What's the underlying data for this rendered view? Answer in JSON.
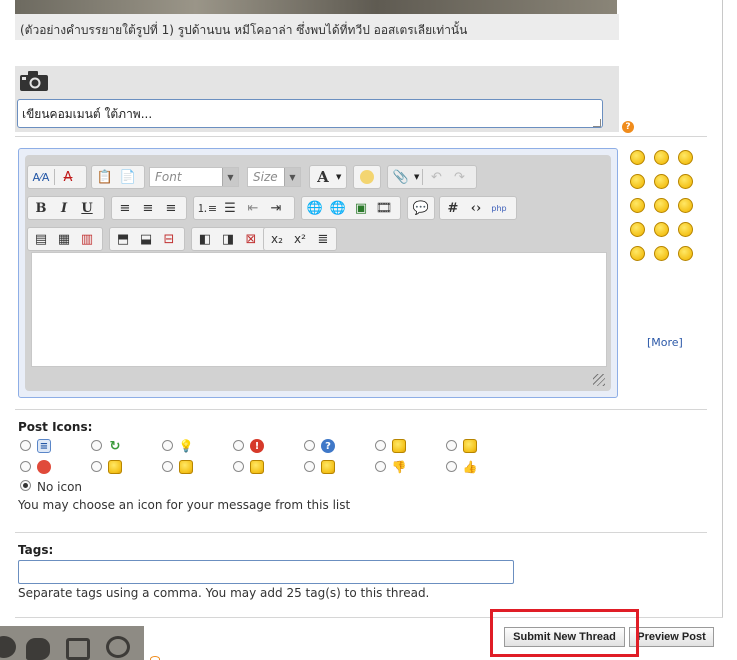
{
  "caption": "(ตัวอย่างคำบรรยายใต้รูปที่ 1) รูปด้านบน หมีโคอาล่า ซึ่งพบได้ที่ทวีป ออสเตรเลียเท่านั้น",
  "comment_placeholder": "เขียนคอมเมนต์ ใต้ภาพ...",
  "editor": {
    "font_label": "Font",
    "size_label": "Size",
    "text_color_label": "A"
  },
  "smilies_more": "[More]",
  "post_icons": {
    "title": "Post Icons:",
    "no_icon_label": "No icon",
    "hint": "You may choose an icon for your message from this list",
    "icons_row1": [
      "document-icon",
      "recycle-icon",
      "lightbulb-icon",
      "exclamation-icon",
      "question-icon",
      "cool-smiley-icon",
      "smile-icon"
    ],
    "icons_row2": [
      "angry-icon",
      "frown-icon",
      "embarrassed-icon",
      "happy-icon",
      "grin-icon",
      "thumbs-down-icon",
      "thumbs-up-icon"
    ]
  },
  "tags": {
    "title": "Tags:",
    "value": "",
    "hint": "Separate tags using a comma. You may add 25 tag(s) to this thread."
  },
  "buttons": {
    "submit": "Submit New Thread",
    "preview": "Preview Post"
  },
  "colors": {
    "highlight_border": "#e01d26",
    "link": "#2b58a8",
    "input_border": "#6b8fc0"
  }
}
